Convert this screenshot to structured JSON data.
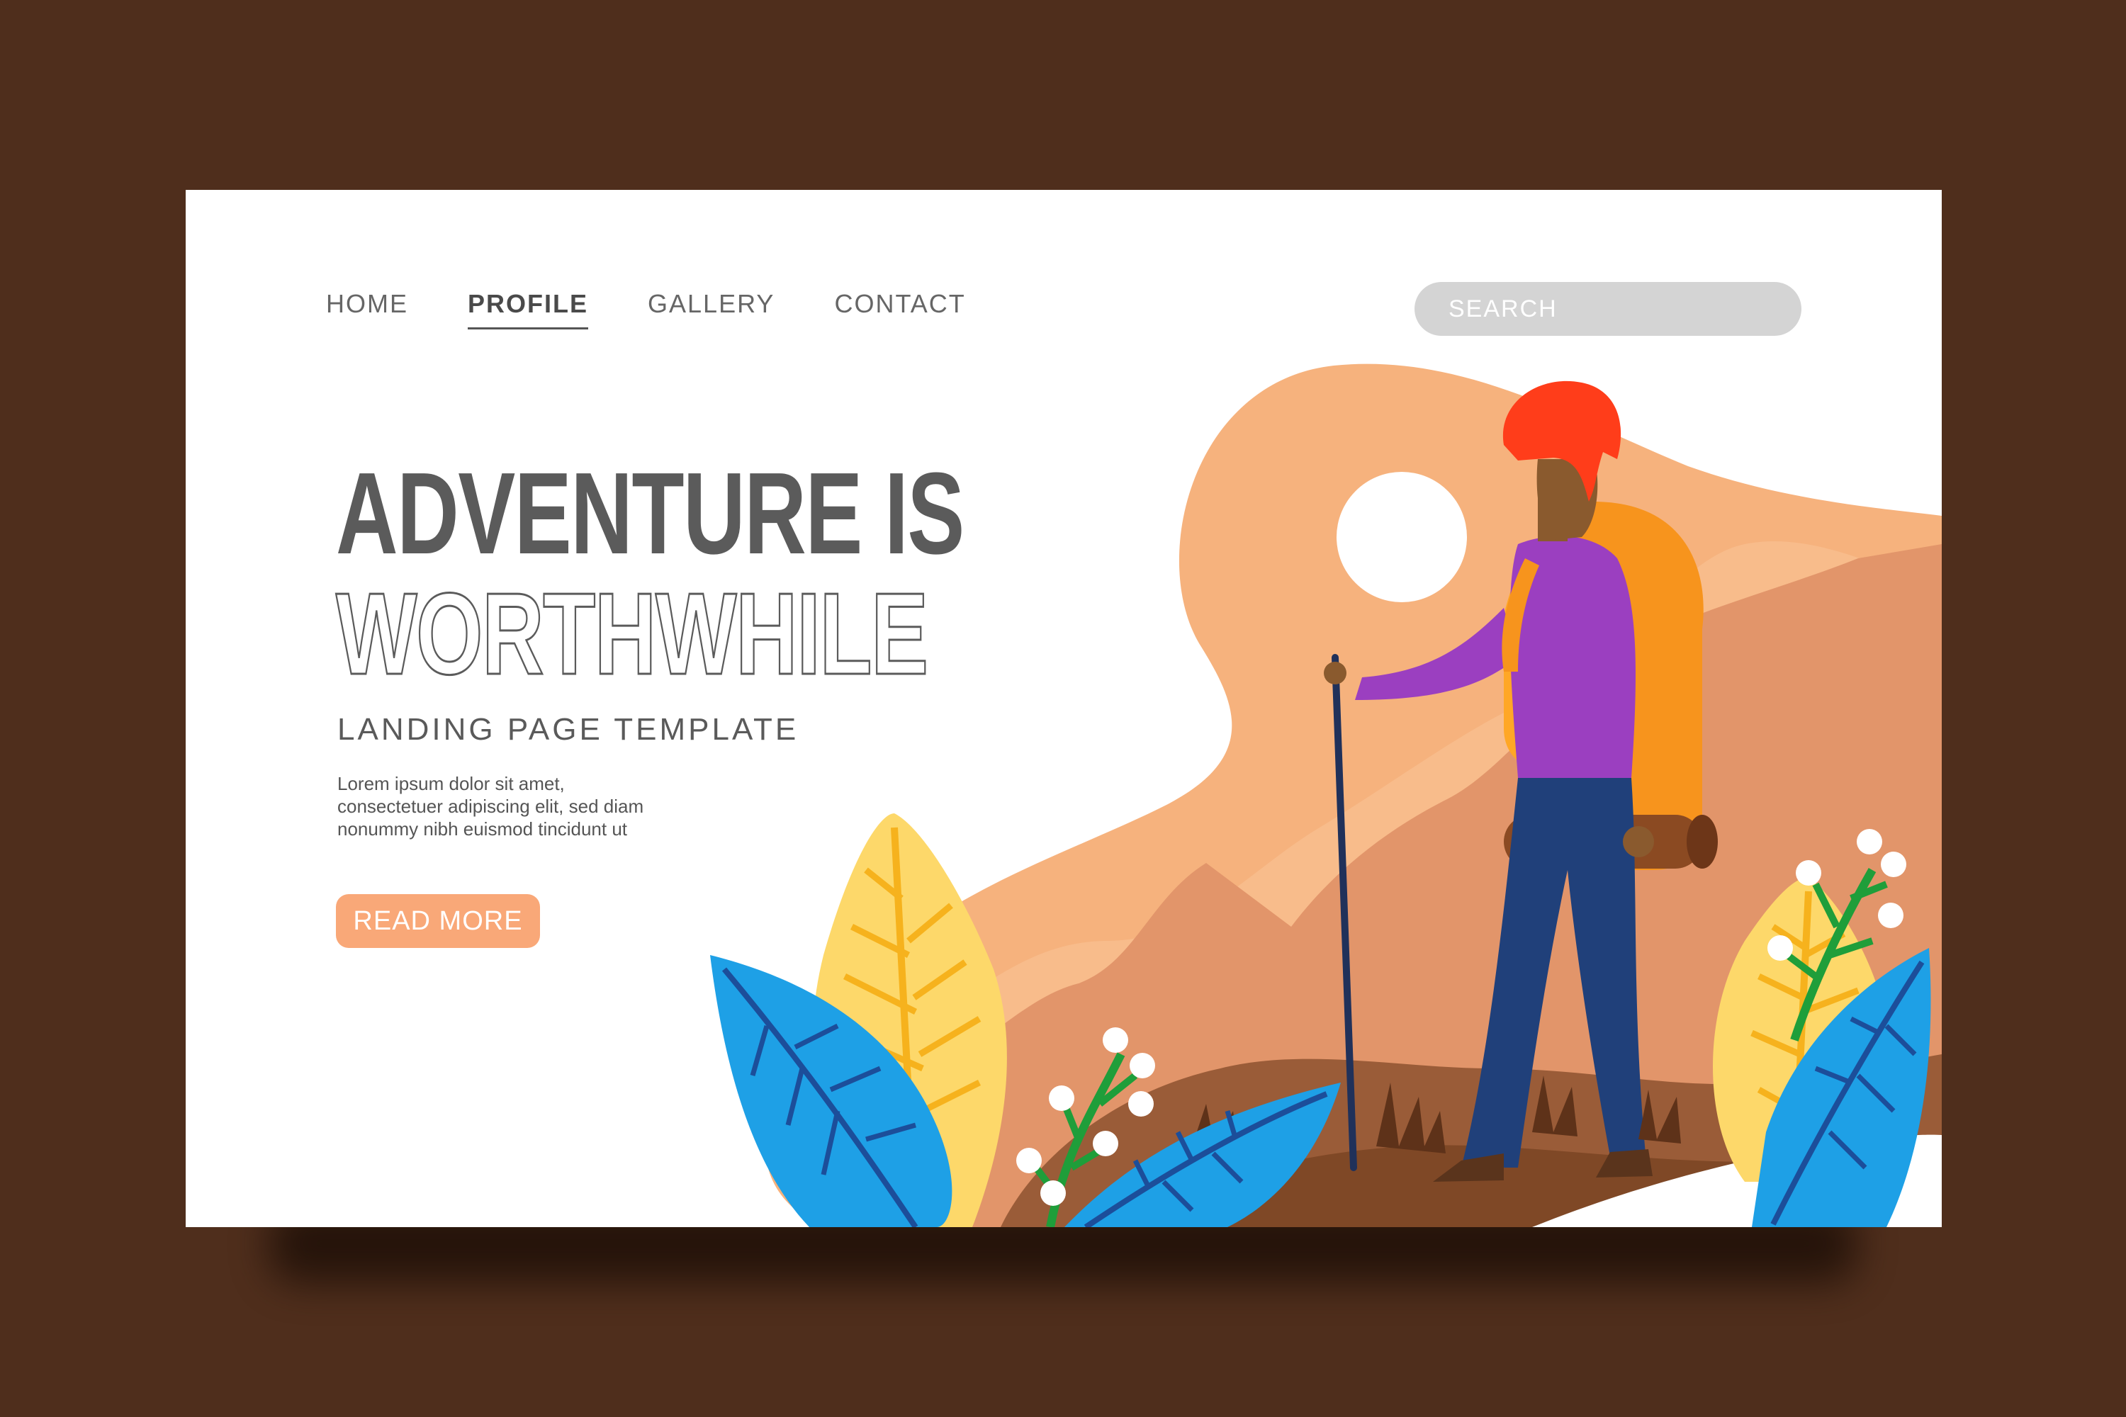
{
  "nav": {
    "items": [
      {
        "label": "HOME"
      },
      {
        "label": "PROFILE"
      },
      {
        "label": "GALLERY"
      },
      {
        "label": "CONTACT"
      }
    ],
    "active": "PROFILE"
  },
  "search": {
    "placeholder": "SEARCH"
  },
  "hero": {
    "title_line1": "ADVENTURE IS",
    "title_line2": "WORTHWHILE",
    "subtitle": "LANDING PAGE TEMPLATE",
    "body_line1": "Lorem ipsum dolor sit amet,",
    "body_line2": "consectetuer adipiscing elit, sed diam",
    "body_line3": "nonummy nibh euismod tincidunt ut",
    "cta_label": "READ MORE"
  },
  "colors": {
    "background": "#4f2e1c",
    "card": "#ffffff",
    "accent": "#f9a878",
    "heading": "#5b5b5b"
  },
  "illustration": {
    "icons": [
      "sun-icon",
      "mountain-icon",
      "hiker-icon",
      "leaf-icon",
      "flower-icon"
    ]
  }
}
